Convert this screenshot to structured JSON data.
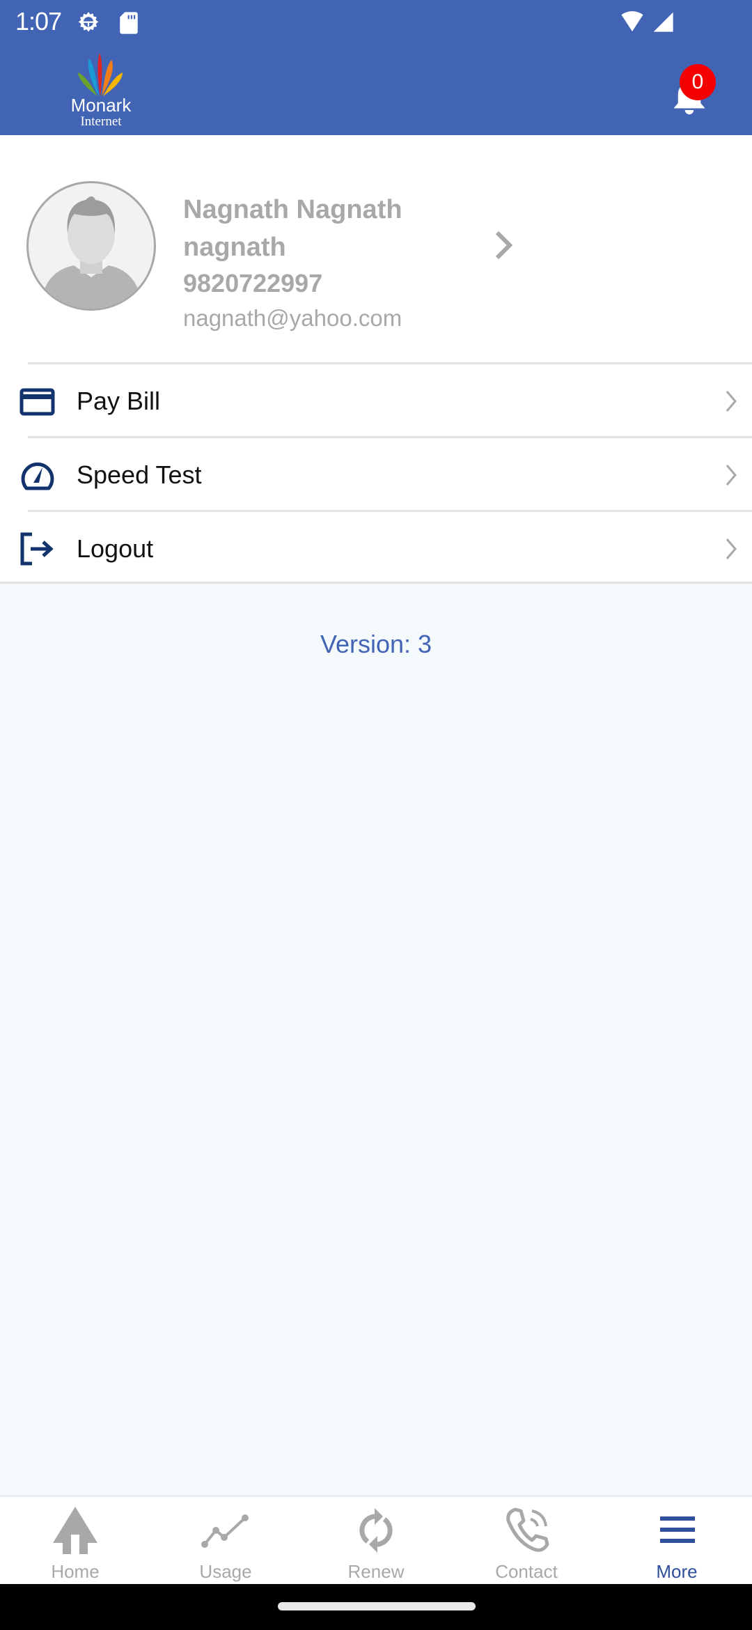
{
  "status_bar": {
    "time": "1:07",
    "icons": [
      "settings-gear-icon",
      "sd-card-icon",
      "wifi-icon",
      "cell-signal-icon"
    ]
  },
  "header": {
    "logo": {
      "brand": "Monark",
      "sub": "Internet"
    },
    "notifications": {
      "icon": "bell-icon",
      "count": "0"
    }
  },
  "profile": {
    "name": "Nagnath Nagnath nagnath",
    "phone": "9820722997",
    "email": "nagnath@yahoo.com",
    "avatar_icon": "user-avatar-icon"
  },
  "menu": {
    "items": [
      {
        "label": "Pay Bill",
        "icon": "credit-card-icon"
      },
      {
        "label": "Speed Test",
        "icon": "speedometer-icon"
      },
      {
        "label": "Logout",
        "icon": "logout-icon"
      }
    ]
  },
  "version": "Version: 3",
  "bottom_nav": {
    "items": [
      {
        "label": "Home",
        "icon": "home-icon",
        "active": false
      },
      {
        "label": "Usage",
        "icon": "usage-chart-icon",
        "active": false
      },
      {
        "label": "Renew",
        "icon": "renew-icon",
        "active": false
      },
      {
        "label": "Contact",
        "icon": "phone-icon",
        "active": false
      },
      {
        "label": "More",
        "icon": "menu-icon",
        "active": true
      }
    ]
  },
  "colors": {
    "primary": "#4264b4",
    "badge": "#f40000",
    "icon_dark": "#12336b",
    "inactive": "#a8a8a8",
    "background": "#f4f9fc"
  }
}
